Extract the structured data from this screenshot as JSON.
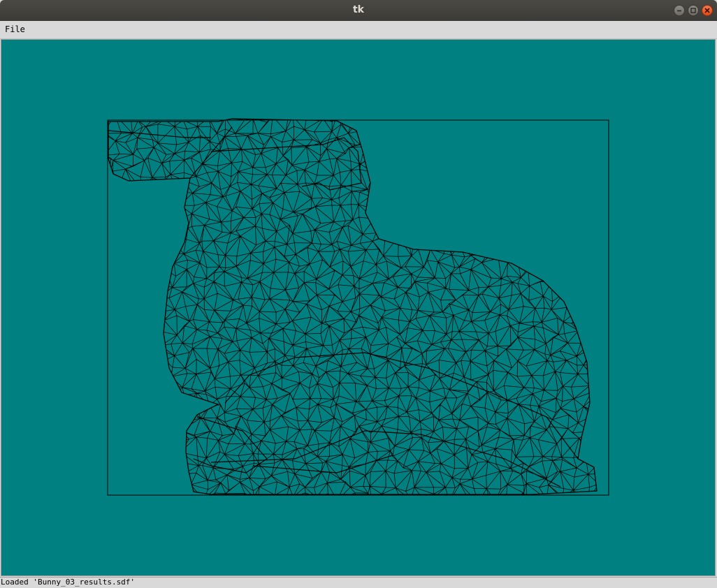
{
  "window": {
    "title": "tk"
  },
  "menubar": {
    "items": [
      {
        "label": "File"
      }
    ]
  },
  "canvas": {
    "background_color": "#008080",
    "wireframe_color": "#000000",
    "content": "bunny-wireframe-mesh"
  },
  "statusbar": {
    "text": "Loaded 'Bunny_03_results.sdf'"
  },
  "icons": {
    "minimize": "minimize-icon",
    "maximize": "maximize-icon",
    "close": "close-icon"
  }
}
